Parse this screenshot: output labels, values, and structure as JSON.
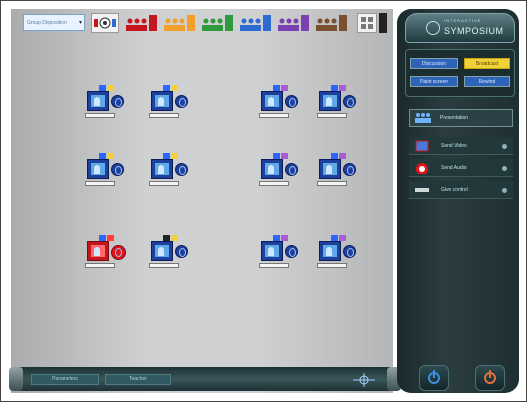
{
  "toolbar": {
    "group_select": {
      "value": "Group Disposition",
      "options_visible": false
    },
    "buttons": [
      {
        "name": "all-groups-button",
        "icon": "broadcast-group-icon"
      },
      {
        "name": "group-red-button",
        "icon": "people-red-icon",
        "color": "#c4161c"
      },
      {
        "name": "group-orange-button",
        "icon": "people-orange-icon",
        "color": "#f3a02a"
      },
      {
        "name": "group-green-button",
        "icon": "people-green-icon",
        "color": "#2f9a3d"
      },
      {
        "name": "group-blue-button",
        "icon": "people-blue-icon",
        "color": "#2e6bd1"
      },
      {
        "name": "group-purple-button",
        "icon": "people-purple-icon",
        "color": "#7a3fb0"
      },
      {
        "name": "group-brown-button",
        "icon": "people-brown-icon",
        "color": "#7a5030"
      },
      {
        "name": "grid-layout-button",
        "icon": "grid-icon"
      }
    ]
  },
  "workstations": [
    {
      "id": "ws-1",
      "sq1": "#2e64ff",
      "sq2": "#f3d13a",
      "alert": false,
      "tag": ""
    },
    {
      "id": "ws-2",
      "sq1": "#2e64ff",
      "sq2": "#f3d13a",
      "alert": false,
      "tag": ""
    },
    {
      "id": "ws-3",
      "sq1": "#2e64ff",
      "sq2": "#a95cd6",
      "alert": false,
      "tag": ""
    },
    {
      "id": "ws-4",
      "sq1": "#2e64ff",
      "sq2": "#a95cd6",
      "alert": false,
      "tag": ""
    },
    {
      "id": "ws-5",
      "sq1": "#2e64ff",
      "sq2": "#f3d13a",
      "alert": false,
      "tag": ""
    },
    {
      "id": "ws-6",
      "sq1": "#2e64ff",
      "sq2": "#f3d13a",
      "alert": false,
      "tag": ""
    },
    {
      "id": "ws-7",
      "sq1": "#2e64ff",
      "sq2": "#a95cd6",
      "alert": false,
      "tag": ""
    },
    {
      "id": "ws-8",
      "sq1": "#2e64ff",
      "sq2": "#a95cd6",
      "alert": false,
      "tag": ""
    },
    {
      "id": "ws-9",
      "sq1": "#2e64ff",
      "sq2": "#ff3b3b",
      "alert": true,
      "tag": "tx"
    },
    {
      "id": "ws-10",
      "sq1": "#222222",
      "sq2": "#f3d13a",
      "alert": false,
      "tag": ""
    },
    {
      "id": "ws-11",
      "sq1": "#2e64ff",
      "sq2": "#a95cd6",
      "alert": false,
      "tag": ""
    },
    {
      "id": "ws-12",
      "sq1": "#2e64ff",
      "sq2": "#a95cd6",
      "alert": false,
      "tag": ""
    }
  ],
  "bottom_bar": {
    "buttons": [
      "Parameters",
      "Teacher"
    ],
    "crosshair_icon": "crosshair-icon"
  },
  "logo": {
    "small_text": "INTERACTIVE",
    "brand": "SYMPOSIUM"
  },
  "controls": {
    "buttons": [
      "Discussion",
      "Broadcast",
      "Paint screen",
      "Rewind"
    ]
  },
  "presentation": {
    "label": "Presentation",
    "icon": "presentation-group-icon"
  },
  "menu_items": [
    {
      "label": "Send Video",
      "icon": "video-icon"
    },
    {
      "label": "Send Audio",
      "icon": "audio-icon"
    },
    {
      "label": "Give control",
      "icon": "keyboard-icon"
    }
  ],
  "power": [
    {
      "name": "shutdown-button",
      "icon": "power-icon",
      "color": "#3c8fe0"
    },
    {
      "name": "restart-button",
      "icon": "power-alt-icon",
      "color": "#e0703c"
    }
  ]
}
